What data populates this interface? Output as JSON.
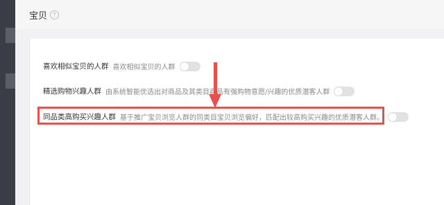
{
  "section": {
    "title": "宝贝"
  },
  "rows": [
    {
      "label": "喜欢相似宝贝的人群",
      "desc": "喜欢相似宝贝的人群",
      "toggle_on": false
    },
    {
      "label": "精选购物兴趣人群",
      "desc": "由系统智能优选出对商品及其类目商品有强购物意愿/兴趣的优质潜客人群",
      "toggle_on": false
    },
    {
      "label": "同品类高购买兴趣人群",
      "desc": "基于推广宝贝浏览人群的同类目宝贝浏览偏好，匹配出较高购买兴趣的优质潜客人群。",
      "toggle_on": false
    }
  ],
  "colors": {
    "highlight": "#e4514f",
    "toggle_off": "#e2e2e2"
  }
}
